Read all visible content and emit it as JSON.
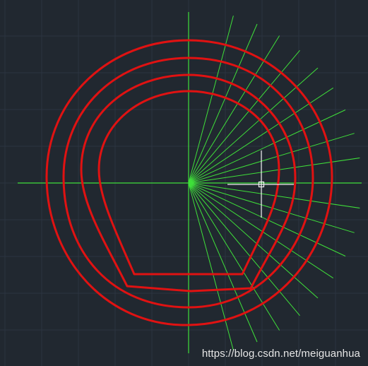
{
  "viewport": {
    "background_color": "#212830",
    "grid_color": "#2c3440",
    "axis_color": "#3fe03a",
    "ray_color": "#3fe03a",
    "contour_color": "#e01212",
    "cursor_color": "#f2f2f2"
  },
  "rays": {
    "count": 19,
    "start_angle_deg": 75,
    "end_angle_deg": -75
  },
  "contours": {
    "count": 4
  },
  "watermark": {
    "text": "https://blog.csdn.net/meiguanhua"
  }
}
